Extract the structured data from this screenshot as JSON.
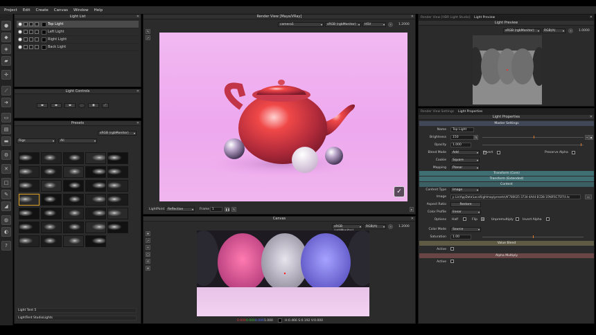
{
  "menu": [
    "Project",
    "Edit",
    "Create",
    "Canvas",
    "Window",
    "Help"
  ],
  "light_list": {
    "title": "Light List",
    "lights": [
      "Top Light",
      "Left Light",
      "Right Light",
      "Back Light"
    ]
  },
  "light_controls": {
    "title": "Light Controls"
  },
  "presets": {
    "title": "Presets",
    "colorspace": "sRGB (rgbMonitor)",
    "filter1": "Rigs",
    "filter2": "All",
    "footer1": "Light Tent 5",
    "footer2": "LightTent StudioLights"
  },
  "render_view": {
    "title": "Render View [Maya/VRay]",
    "camera": "camera1",
    "colorspace": "sRGB (rgbMonitor)",
    "channel": "HSV",
    "exposure": "1.2000",
    "lightpaint_label": "LightPaint",
    "lightpaint_mode": "Reflection",
    "frame_label": "Frame",
    "frame_value": "1"
  },
  "canvas": {
    "title": "Canvas",
    "colorspace": "sRGB (rgbMonitor)",
    "channel": "RGB(A)",
    "exposure": "1.2000",
    "pixel_r": "0.000",
    "pixel_g": "0.000",
    "pixel_b": "0.000",
    "pixel_a": "1.000",
    "hsv_readout": "H:0.466 S:0.192 V:0.000"
  },
  "right_tabs": {
    "tab1": "Render View [HDR Light Studio]",
    "tab2": "Light Preview"
  },
  "light_preview": {
    "title": "Light Preview",
    "colorspace": "sRGB (rgbMonitor)",
    "channel": "RGB(A)",
    "exposure": "1.0000"
  },
  "bottom_tabs": {
    "tab1": "Render View Settings",
    "tab2": "Light Properties"
  },
  "light_properties": {
    "title": "Light Properties",
    "master": "Master Settings",
    "name_label": "Name",
    "name_value": "Top Light",
    "brightness_label": "Brightness",
    "brightness_value": "150",
    "opacity_label": "Opacity",
    "opacity_value": "1.000",
    "blend_label": "Blend Mode",
    "blend_value": "Add",
    "invert_label": "Invert",
    "preserve_alpha_label": "Preserve Alpha",
    "cookie_label": "Cookie",
    "cookie_value": "Square",
    "mapping_label": "Mapping",
    "mapping_value": "Planar",
    "transform_core": "Transform (Core)",
    "transform_ext": "Transform (Extended)",
    "content": "Content",
    "content_type_label": "Content Type",
    "content_type_value": "Image",
    "image_label": "Image",
    "image_path": "p Lix\\AppData\\Local\\lightmap\\presets\\AF780025-3734-4A44-ECD8-1FA8F6C75FF4.tx",
    "aspect_label": "Aspect Ratio",
    "aspect_btn": "Restore",
    "color_profile_label": "Color Profile",
    "color_profile_value": "linear",
    "options_label": "Options",
    "half_label": "Half",
    "flip_label": "Flip",
    "unpremultiply_label": "Unpremultiply",
    "invert_alpha_label": "Invert Alpha",
    "color_mode_label": "Color Mode",
    "color_mode_value": "Source",
    "saturation_label": "Saturation",
    "saturation_value": "1.00",
    "value_blend": "Value Blend",
    "active_label": "Active",
    "alpha_multiply": "Alpha Multiply",
    "active2_label": "Active"
  },
  "colors": {
    "transform_bar": "#3f6f73",
    "content_bar": "#3c5f63",
    "value_bar": "#5e5a44",
    "alpha_bar": "#6a4545",
    "master_bar": "#404858"
  }
}
